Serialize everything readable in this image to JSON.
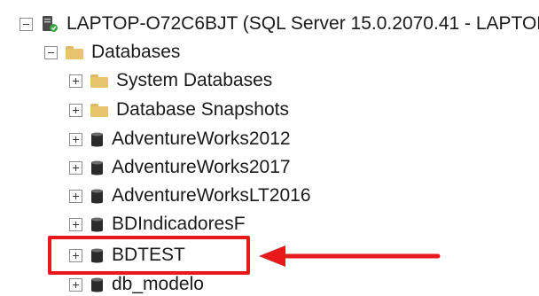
{
  "server": {
    "label": "LAPTOP-O72C6BJT (SQL Server 15.0.2070.41 - LAPTOP",
    "icon": "server-icon",
    "expanded": true
  },
  "databases_folder": {
    "label": "Databases",
    "icon": "folder-icon",
    "expanded": true
  },
  "items": [
    {
      "label": "System Databases",
      "icon": "folder-icon",
      "expanded": false
    },
    {
      "label": "Database Snapshots",
      "icon": "folder-icon",
      "expanded": false
    },
    {
      "label": "AdventureWorks2012",
      "icon": "database-icon",
      "expanded": false
    },
    {
      "label": "AdventureWorks2017",
      "icon": "database-icon",
      "expanded": false
    },
    {
      "label": "AdventureWorksLT2016",
      "icon": "database-icon",
      "expanded": false
    },
    {
      "label": "BDIndicadoresF",
      "icon": "database-icon",
      "expanded": false
    },
    {
      "label": "BDTEST",
      "icon": "database-icon",
      "expanded": false,
      "highlighted": true
    },
    {
      "label": "db_modelo",
      "icon": "database-icon",
      "expanded": false
    }
  ],
  "colors": {
    "highlight": "#e8191b",
    "folder": "#e8c46c",
    "database": "#2b2b2b",
    "server_status": "#3aa341"
  }
}
